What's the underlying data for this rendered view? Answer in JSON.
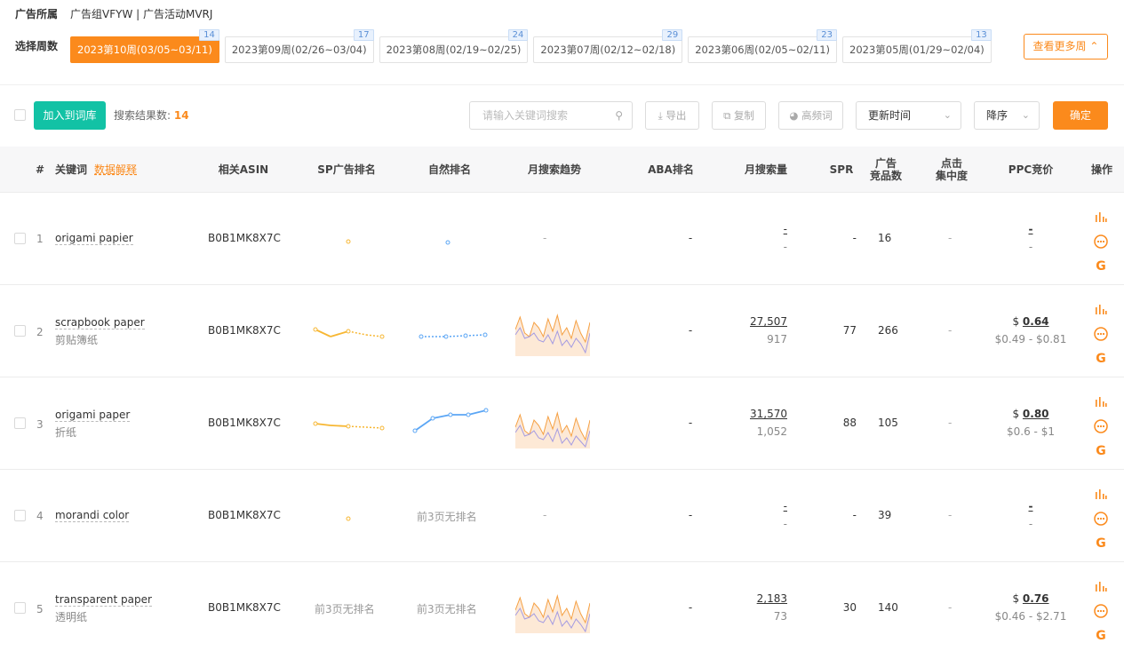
{
  "header": {
    "label": "广告所属",
    "value": "广告组VFYW | 广告活动MVRJ"
  },
  "weeks": {
    "label": "选择周数",
    "items": [
      {
        "label": "2023第10周(03/05~03/11)",
        "count": "14",
        "active": true
      },
      {
        "label": "2023第09周(02/26~03/04)",
        "count": "17"
      },
      {
        "label": "2023第08周(02/19~02/25)",
        "count": "24"
      },
      {
        "label": "2023第07周(02/12~02/18)",
        "count": "29"
      },
      {
        "label": "2023第06周(02/05~02/11)",
        "count": "23"
      },
      {
        "label": "2023第05周(01/29~02/04)",
        "count": "13"
      }
    ],
    "more_label": "查看更多周"
  },
  "toolbar": {
    "add_label": "加入到词库",
    "result_label": "搜索结果数:",
    "result_count": "14",
    "search_placeholder": "请输入关键词搜索",
    "export_label": "导出",
    "copy_label": "复制",
    "freq_label": "高频词",
    "sort_field": "更新时间",
    "sort_order": "降序",
    "confirm_label": "确定"
  },
  "columns": {
    "index": "#",
    "keyword": "关键词",
    "keyword_link": "数据解释",
    "asin": "相关ASIN",
    "sp_rank": "SP广告排名",
    "natural_rank": "自然排名",
    "trend": "月搜索趋势",
    "aba_rank": "ABA排名",
    "monthly_volume": "月搜索量",
    "spr": "SPR",
    "ad_products_l1": "广告",
    "ad_products_l2": "竞品数",
    "click_conc_l1": "点击",
    "click_conc_l2": "集中度",
    "ppc": "PPC竞价",
    "actions": "操作"
  },
  "rows": [
    {
      "index": "1",
      "keyword": "origami papier",
      "keyword_cn": "",
      "asin": "B0B1MK8X7C",
      "natural_text": "",
      "sp_text": "",
      "trend_text": "-",
      "aba": "-",
      "volume": "-",
      "volume_sub": "-",
      "spr": "-",
      "ad_products": "16",
      "click_conc": "-",
      "ppc": "-",
      "ppc_currency": "",
      "ppc_range": "-"
    },
    {
      "index": "2",
      "keyword": "scrapbook paper",
      "keyword_cn": "剪贴簿纸",
      "asin": "B0B1MK8X7C",
      "natural_text": "",
      "sp_text": "",
      "trend_text": "",
      "aba": "-",
      "volume": "27,507",
      "volume_sub": "917",
      "spr": "77",
      "ad_products": "266",
      "click_conc": "-",
      "ppc": "0.64",
      "ppc_currency": "$",
      "ppc_range": "$0.49 - $0.81"
    },
    {
      "index": "3",
      "keyword": "origami paper",
      "keyword_cn": "折纸",
      "asin": "B0B1MK8X7C",
      "natural_text": "",
      "sp_text": "",
      "trend_text": "",
      "aba": "-",
      "volume": "31,570",
      "volume_sub": "1,052",
      "spr": "88",
      "ad_products": "105",
      "click_conc": "-",
      "ppc": "0.80",
      "ppc_currency": "$",
      "ppc_range": "$0.6 - $1"
    },
    {
      "index": "4",
      "keyword": "morandi color",
      "keyword_cn": "",
      "asin": "B0B1MK8X7C",
      "natural_text": "前3页无排名",
      "sp_text": "",
      "trend_text": "-",
      "aba": "-",
      "volume": "-",
      "volume_sub": "-",
      "spr": "-",
      "ad_products": "39",
      "click_conc": "-",
      "ppc": "-",
      "ppc_currency": "",
      "ppc_range": "-"
    },
    {
      "index": "5",
      "keyword": "transparent paper",
      "keyword_cn": "透明纸",
      "asin": "B0B1MK8X7C",
      "natural_text": "前3页无排名",
      "sp_text": "前3页无排名",
      "trend_text": "",
      "aba": "-",
      "volume": "2,183",
      "volume_sub": "73",
      "spr": "30",
      "ad_products": "140",
      "click_conc": "-",
      "ppc": "0.76",
      "ppc_currency": "$",
      "ppc_range": "$0.46 - $2.71"
    }
  ],
  "colors": {
    "accent": "#fb8a1c",
    "add_button": "#12c2a5",
    "week_badge": "#5a8fd6",
    "natural_line": "#5ba6f5",
    "sp_line": "#f7b733",
    "trend_line1": "#f5a043",
    "trend_line2": "#a49be2"
  },
  "icons": {
    "search": "search-icon",
    "export": "download-icon",
    "copy": "copy-icon",
    "freq": "pie-icon",
    "chart": "bar-chart-icon",
    "more": "more-icon",
    "google": "google-icon"
  }
}
